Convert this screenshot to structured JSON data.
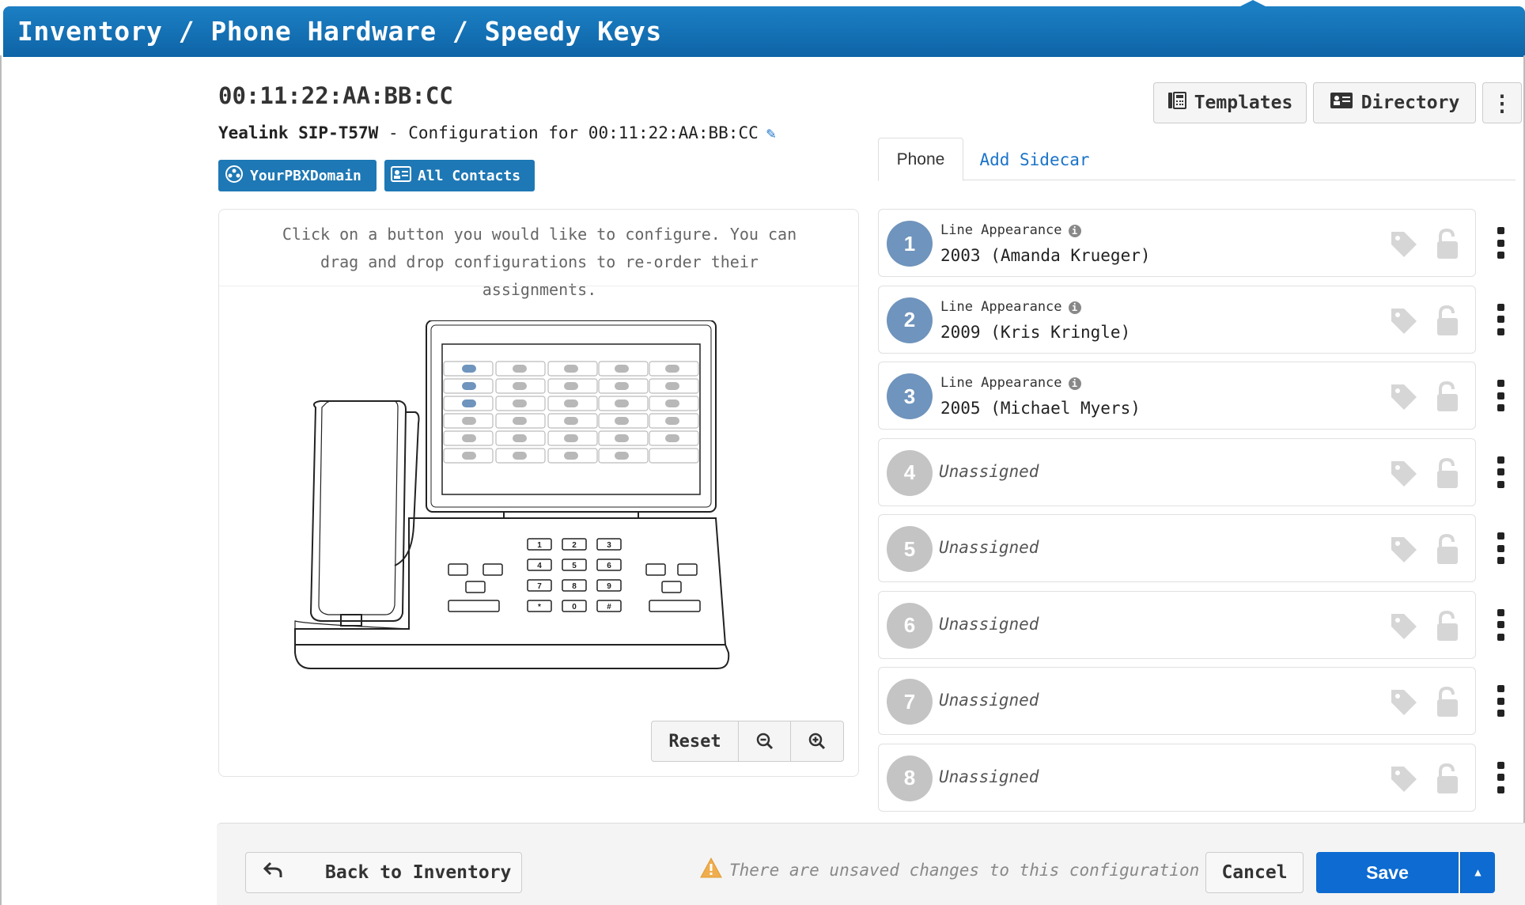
{
  "header": {
    "breadcrumb": "Inventory / Phone Hardware / Speedy Keys"
  },
  "device": {
    "mac": "00:11:22:AA:BB:CC",
    "model": "Yealink SIP-T57W",
    "config_label": " - Configuration for 00:11:22:AA:BB:CC"
  },
  "chips": {
    "domain": "YourPBXDomain",
    "contacts": "All Contacts"
  },
  "panel": {
    "help_text": "Click on a button you would like to configure. You can drag and drop configurations to re-order their assignments.",
    "reset_label": "Reset",
    "zoom_out_icon": "zoom-out-icon",
    "zoom_in_icon": "zoom-in-icon"
  },
  "toolbar": {
    "templates_label": "Templates",
    "directory_label": "Directory"
  },
  "tabs": {
    "phone": "Phone",
    "add_sidecar": "Add Sidecar"
  },
  "keys": [
    {
      "num": "1",
      "type": "Line Appearance",
      "value": "2003 (Amanda Krueger)",
      "assigned": true
    },
    {
      "num": "2",
      "type": "Line Appearance",
      "value": "2009 (Kris Kringle)",
      "assigned": true
    },
    {
      "num": "3",
      "type": "Line Appearance",
      "value": "2005 (Michael Myers)",
      "assigned": true
    },
    {
      "num": "4",
      "value": "Unassigned",
      "assigned": false
    },
    {
      "num": "5",
      "value": "Unassigned",
      "assigned": false
    },
    {
      "num": "6",
      "value": "Unassigned",
      "assigned": false
    },
    {
      "num": "7",
      "value": "Unassigned",
      "assigned": false
    },
    {
      "num": "8",
      "value": "Unassigned",
      "assigned": false
    }
  ],
  "footer": {
    "back_label": "Back to Inventory",
    "warning": "There are unsaved changes to this configuration",
    "cancel_label": "Cancel",
    "save_label": "Save"
  },
  "colors": {
    "header": "#1c7fc4",
    "assigned": "#6f94bd",
    "unassigned": "#c4c4c4",
    "save": "#0d6bd1"
  }
}
